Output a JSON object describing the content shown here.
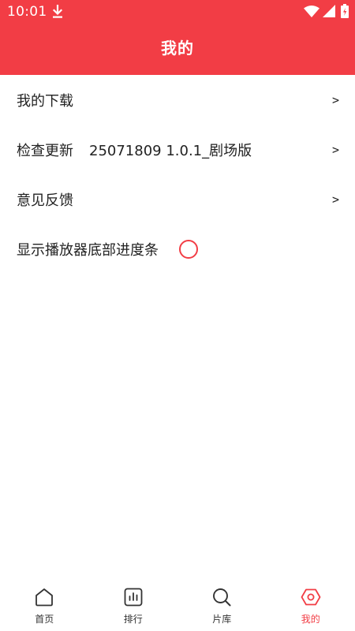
{
  "status_bar": {
    "time": "10:01",
    "icons": [
      "download-icon",
      "wifi-icon",
      "cell-signal-icon",
      "battery-icon"
    ]
  },
  "app_bar": {
    "title": "我的"
  },
  "menu": {
    "items": [
      {
        "label": "我的下载",
        "chevron": ">"
      },
      {
        "label": "检查更新",
        "value": "25071809 1.0.1_剧场版",
        "chevron": ">"
      },
      {
        "label": "意见反馈",
        "chevron": ">"
      },
      {
        "label": "显示播放器底部进度条",
        "toggle_checked": false
      }
    ]
  },
  "bottom_nav": {
    "items": [
      {
        "label": "首页",
        "icon": "home-icon",
        "active": false
      },
      {
        "label": "排行",
        "icon": "ranking-icon",
        "active": false
      },
      {
        "label": "片库",
        "icon": "search-icon",
        "active": false
      },
      {
        "label": "我的",
        "icon": "profile-hexagon-icon",
        "active": true
      }
    ]
  },
  "colors": {
    "accent": "#f23d45",
    "text": "#222222",
    "nav_inactive": "#333333",
    "background": "#ffffff"
  }
}
